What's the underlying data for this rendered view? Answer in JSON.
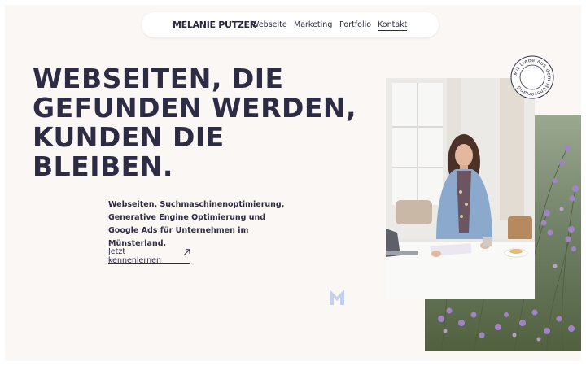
{
  "nav": {
    "brand": "MELANIE PUTZER",
    "items": [
      {
        "label": "Webseite"
      },
      {
        "label": "Marketing"
      },
      {
        "label": "Portfolio"
      },
      {
        "label": "Kontakt"
      }
    ]
  },
  "hero": {
    "headline_lines": [
      "WEBSEITEN, DIE",
      "GEFUNDEN WERDEN,",
      "KUNDEN DIE",
      "BLEIBEN."
    ],
    "subtext": "Webseiten, Suchmaschinenoptimierung, Generative Engine Optimierung und Google Ads für Unternehmen im Münsterland.",
    "cta_label": "Jetzt kennenlernen"
  },
  "badge": {
    "text": "Mit Liebe aus dem Münsterland"
  },
  "colors": {
    "background": "#fbf7f4",
    "text": "#2e2c44",
    "accent_logo": "#c3d2ec"
  },
  "icons": {
    "cta": "arrow-up-right-icon",
    "logo": "m-logo-icon"
  }
}
